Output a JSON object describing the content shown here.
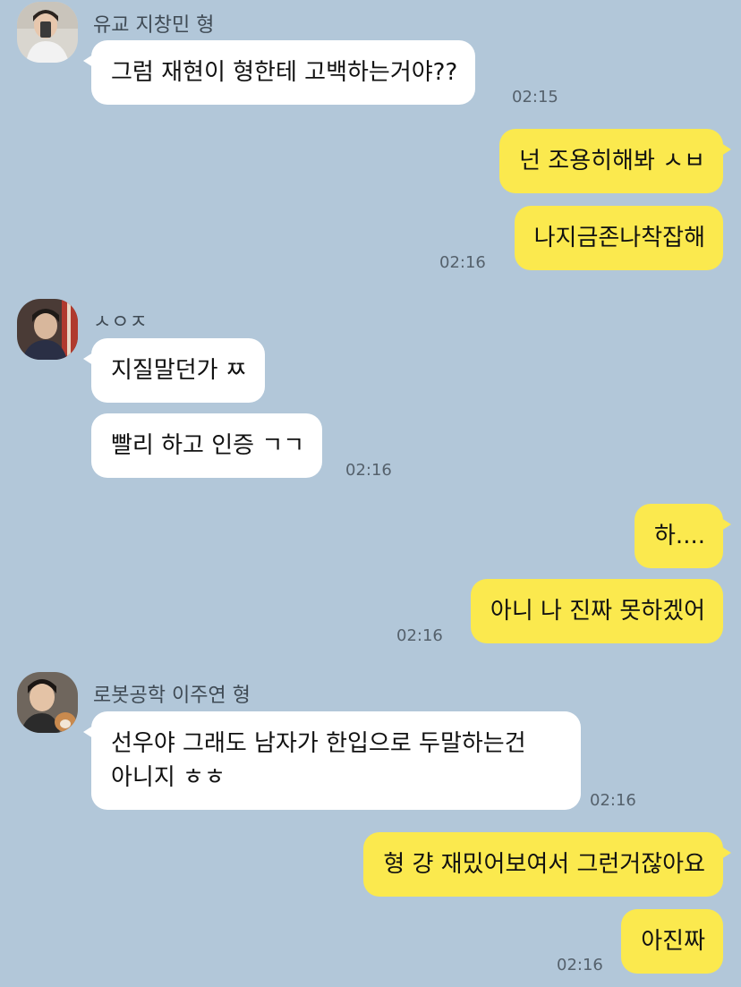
{
  "colors": {
    "background": "#b2c7d9",
    "incoming_bubble": "#ffffff",
    "outgoing_bubble": "#fbe94e"
  },
  "groups": [
    {
      "sender": "유교 지창민 형",
      "avatar_icon": "profile-photo-icon",
      "messages": [
        "그럼 재현이 형한테 고백하는거야??"
      ],
      "time": "02:15"
    },
    {
      "sender": "me",
      "messages": [
        "넌 조용히해봐 ㅅㅂ",
        "나지금존나착잡해"
      ],
      "time": "02:16"
    },
    {
      "sender": "ㅅㅇㅈ",
      "avatar_icon": "profile-photo-icon",
      "messages": [
        "지질말던가 ㅉ",
        "빨리 하고 인증 ㄱㄱ"
      ],
      "time": "02:16"
    },
    {
      "sender": "me",
      "messages": [
        "하....",
        "아니 나 진짜 못하겠어"
      ],
      "time": "02:16"
    },
    {
      "sender": "로봇공학 이주연 형",
      "avatar_icon": "profile-photo-icon",
      "messages": [
        "선우야 그래도 남자가 한입으로 두말하는건",
        "아니지 ㅎㅎ"
      ],
      "time": "02:16"
    },
    {
      "sender": "me",
      "messages": [
        "형 걍 재밌어보여서 그런거잖아요",
        "아진짜"
      ],
      "time": "02:16"
    }
  ]
}
